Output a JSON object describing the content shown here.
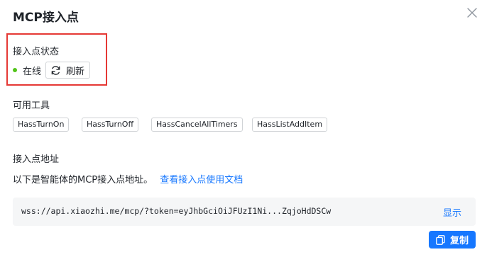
{
  "dialog": {
    "title": "MCP接入点",
    "close_icon": "close-icon"
  },
  "status": {
    "label": "接入点状态",
    "value": "在线",
    "dot_color": "#52c41a",
    "refresh_label": "刷新",
    "refresh_icon": "refresh-icon"
  },
  "tools": {
    "label": "可用工具",
    "items": [
      "HassTurnOn",
      "HassTurnOff",
      "HassCancelAllTimers",
      "HassListAddItem"
    ]
  },
  "endpoint": {
    "label": "接入点地址",
    "description": "以下是智能体的MCP接入点地址。",
    "doc_link": "查看接入点使用文档",
    "url": "wss://api.xiaozhi.me/mcp/?token=eyJhbGciOiJFUzI1Ni...ZqjoHdDSCw",
    "show_label": "显示",
    "copy_label": "复制",
    "copy_icon": "copy-icon"
  },
  "colors": {
    "accent": "#1677ff",
    "highlight_border": "#e53935"
  }
}
